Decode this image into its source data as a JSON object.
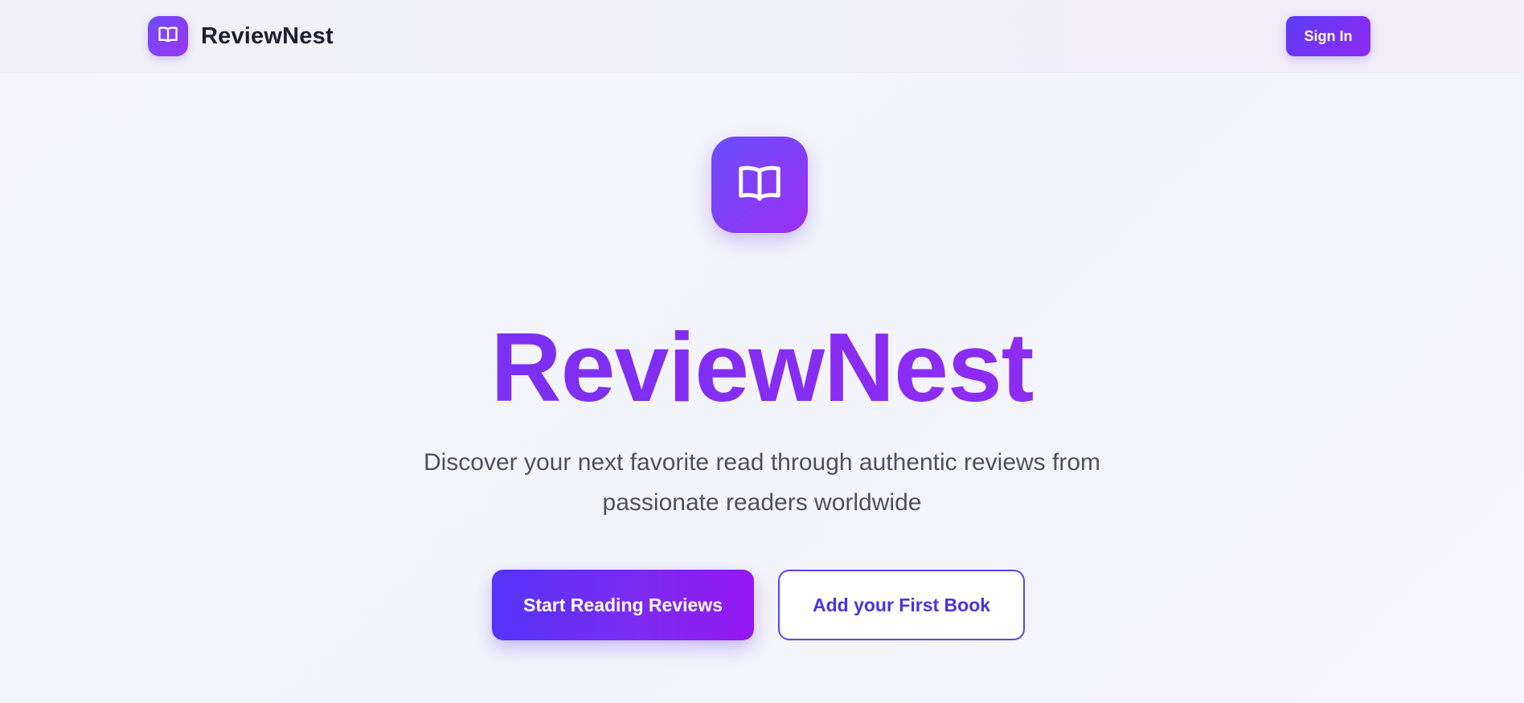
{
  "header": {
    "brand_name": "ReviewNest",
    "brand_icon": "open-book-icon",
    "sign_in_label": "Sign In"
  },
  "hero": {
    "icon": "open-book-icon",
    "title": "ReviewNest",
    "subtitle": "Discover your next favorite read through authentic reviews from passionate readers worldwide",
    "primary_button_label": "Start Reading Reviews",
    "secondary_button_label": "Add your First Book"
  },
  "colors": {
    "accent_start": "#5b3cf6",
    "accent_end": "#9b2ff2",
    "title_text": "#7a2ff2",
    "body_text": "#4b5161",
    "brand_text": "#1c1f33",
    "secondary_button_text": "#4a32e6"
  }
}
